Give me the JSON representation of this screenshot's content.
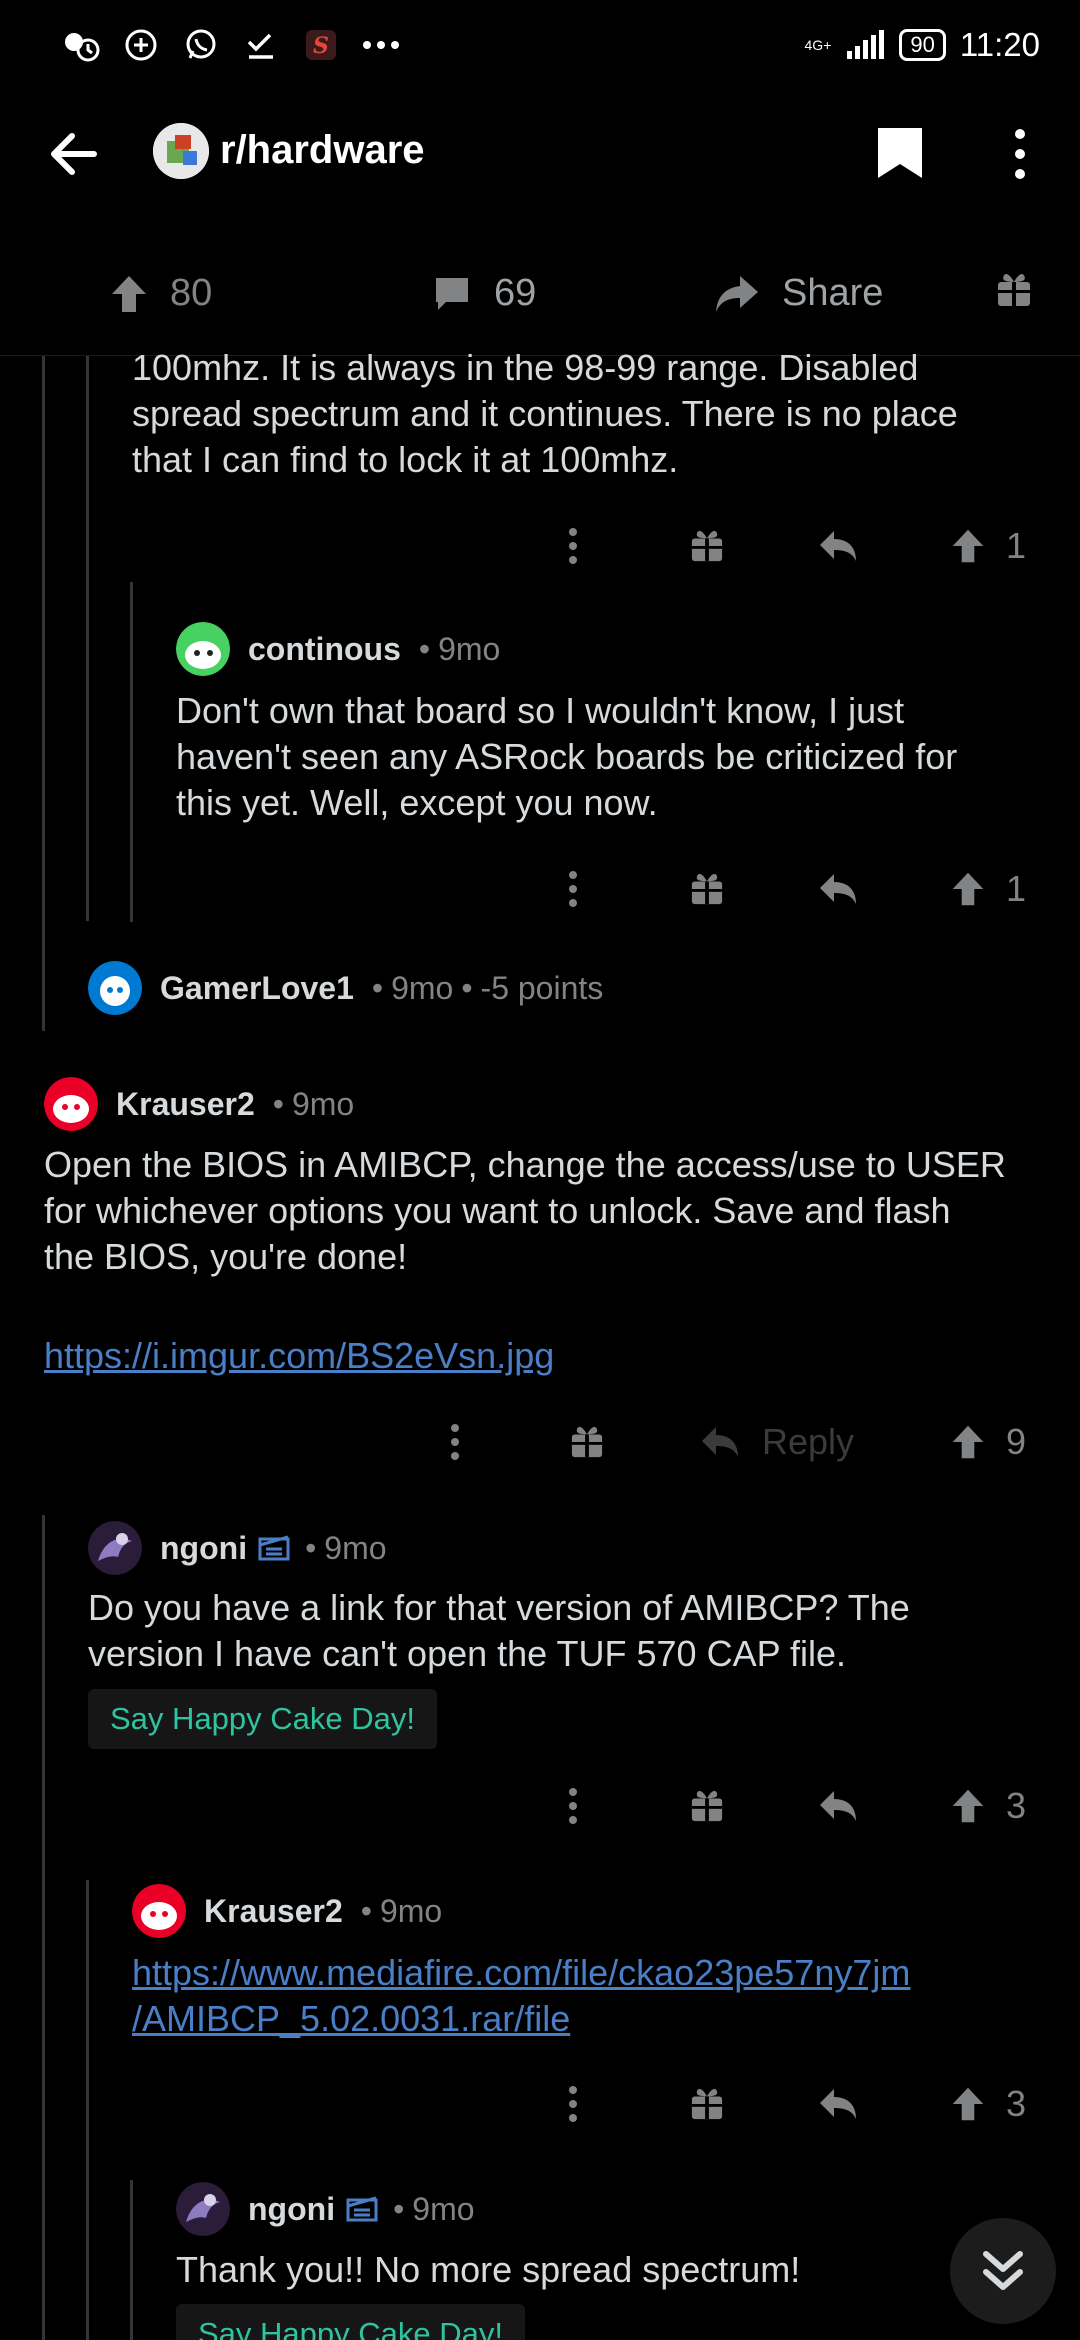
{
  "status_bar": {
    "time": "11:20",
    "battery": "90",
    "network": "4G+"
  },
  "header": {
    "subreddit": "r/hardware"
  },
  "post_actions": {
    "upvotes": "80",
    "comments": "69",
    "share_label": "Share"
  },
  "comments": [
    {
      "id": "partial",
      "text_lines": [
        "100mhz.  It is always in the 98-99 range.  Disabled",
        "spread spectrum and it continues.  There is no place",
        "that I can find to lock it at 100mhz."
      ],
      "score": "1"
    },
    {
      "id": "continous",
      "user": "continous",
      "age": "9mo",
      "text_lines": [
        "Don't own that board so I wouldn't know, I just",
        "haven't seen any ASRock boards be criticized for",
        "this yet. Well, except you now."
      ],
      "score": "1"
    },
    {
      "id": "gamerlove",
      "user": "GamerLove1",
      "age": "9mo",
      "points": "-5 points"
    },
    {
      "id": "krauser1",
      "user": "Krauser2",
      "age": "9mo",
      "text_lines": [
        "Open the BIOS in AMIBCP, change the access/use to USER",
        "for whichever options you want to unlock. Save and flash",
        "the BIOS, you're done!"
      ],
      "link": "https://i.imgur.com/BS2eVsn.jpg",
      "reply_label": "Reply",
      "score": "9"
    },
    {
      "id": "ngoni1",
      "user": "ngoni",
      "age": "9mo",
      "text_lines": [
        "Do you have a link for that version of AMIBCP? The",
        "version I have can't open the TUF 570 CAP file."
      ],
      "cake_day": "Say Happy Cake Day!",
      "score": "3"
    },
    {
      "id": "krauser2",
      "user": "Krauser2",
      "age": "9mo",
      "link_lines": [
        "https://www.mediafire.com/file/ckao23pe57ny7jm",
        "/AMIBCP_5.02.0031.rar/file"
      ],
      "score": "3"
    },
    {
      "id": "ngoni2",
      "user": "ngoni",
      "age": "9mo",
      "text_lines": [
        "Thank you!! No more spread spectrum!"
      ],
      "cake_day": "Say Happy Cake Day!"
    }
  ],
  "colors": {
    "background": "#000000",
    "text": "#d7dadc",
    "muted": "#818384",
    "link": "#4a7fc7",
    "cake_day": "#2ec4a0"
  }
}
